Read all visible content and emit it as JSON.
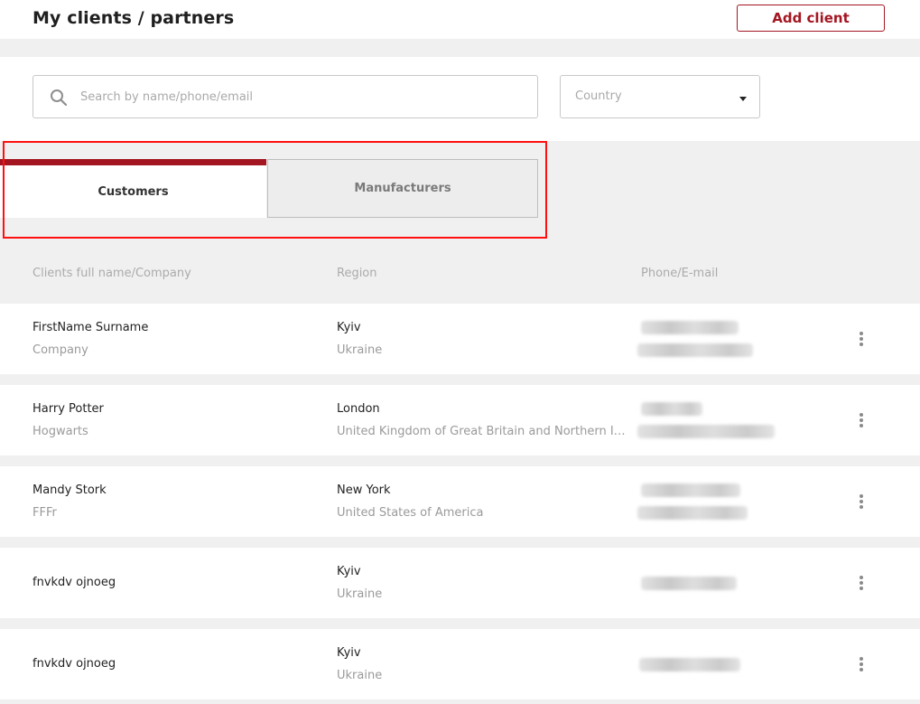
{
  "header": {
    "title": "My clients / partners",
    "add_button": "Add client"
  },
  "filters": {
    "search_placeholder": "Search by name/phone/email",
    "country_label": "Country"
  },
  "tabs": [
    {
      "label": "Customers",
      "active": true
    },
    {
      "label": "Manufacturers",
      "active": false
    }
  ],
  "columns": {
    "name": "Clients full name/Company",
    "region": "Region",
    "contact": "Phone/E-mail"
  },
  "clients": [
    {
      "name": "FirstName Surname",
      "company": "Company",
      "city": "Kyiv",
      "country": "Ukraine"
    },
    {
      "name": "Harry Potter",
      "company": "Hogwarts",
      "city": "London",
      "country": "United Kingdom of Great Britain and Northern Ireland"
    },
    {
      "name": "Mandy Stork",
      "company": "FFFr",
      "city": "New York",
      "country": "United States of America"
    },
    {
      "name": "fnvkdv ojnoeg",
      "company": "",
      "city": "Kyiv",
      "country": "Ukraine"
    },
    {
      "name": "fnvkdv ojnoeg",
      "company": "",
      "city": "Kyiv",
      "country": "Ukraine"
    }
  ],
  "colors": {
    "accent": "#a31621",
    "highlight_box": "#ff1010",
    "band": "#f0f0f0"
  },
  "icons": [
    "search-icon",
    "chevron-down-icon",
    "more-vertical-icon"
  ]
}
